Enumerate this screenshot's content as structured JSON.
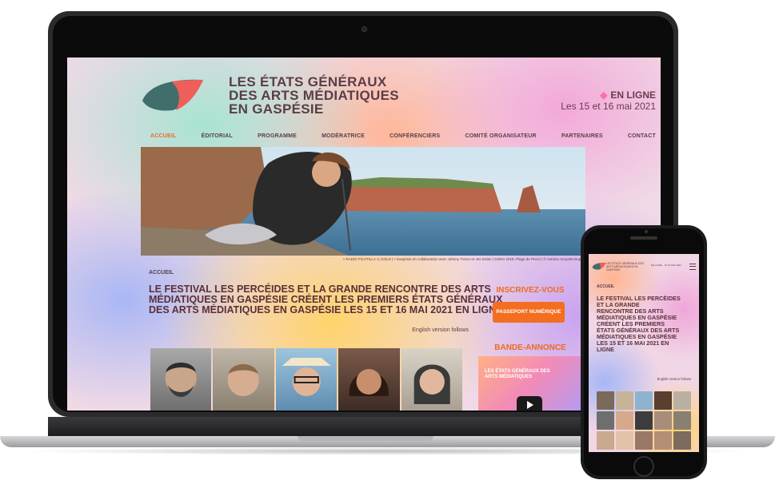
{
  "laptop_site": {
    "title_lines": [
      "LES ÉTATS GÉNÉRAUX",
      "DES ARTS MÉDIATIQUES",
      "EN GASPÉSIE"
    ],
    "online_label": "EN LIGNE",
    "dates": "Les 15 et 16 mai 2021",
    "nav": [
      "ACCUEIL",
      "ÉDITORIAL",
      "PROGRAMME",
      "MODÉRATRICE",
      "CONFÉRENCIERS",
      "COMITÉ ORGANISATEUR",
      "PARTENAIRES",
      "CONTACT"
    ],
    "nav_active": "ACCUEIL",
    "hero_credit": "« RADIO FICATILLA »( GOLD ) • Gaspésie en collaboration avec Johnny Trevor et Jes Dolan | GIWAI 2019, Plage de Percé | © Antoine Amyotte-Dupuis",
    "breadcrumb": "ACCUEIL",
    "headline_lines": [
      "LE FESTIVAL LES PERCÉIDES ET LA GRANDE RENCONTRE DES ARTS",
      "MÉDIATIQUES EN GASPÉSIE CRÉENT LES PREMIERS ÉTATS GÉNÉRAUX",
      "DES ARTS MÉDIATIQUES EN GASPÉSIE LES 15 ET 16 MAI 2021 EN LIGNE"
    ],
    "english_link": "English version follows",
    "inscrivez": "INSCRIVEZ-VOUS",
    "passport_button": "PASSEPORT NUMÉRIQUE",
    "bande_annonce": "BANDE-ANNONCE",
    "video_text": "LES ÉTATS GÉNÉRAUX DES ARTS MÉDIATIQUES"
  },
  "phone_site": {
    "mini_title": "LES ÉTATS GÉNÉRAUX DES ARTS MÉDIATIQUES EN GASPÉSIE",
    "mini_date": "EN LIGNE · 15-16 MAI 2021",
    "breadcrumb": "ACCUEIL",
    "headline_lines": [
      "LE FESTIVAL LES PERCÉIDES",
      "ET LA GRANDE",
      "RENCONTRE DES ARTS",
      "MÉDIATIQUES EN GASPÉSIE",
      "CRÉENT LES PREMIERS",
      "ÉTATS GÉNÉRAUX DES ARTS",
      "MÉDIATIQUES EN GASPÉSIE",
      "LES 15 ET 16 MAI 2021 EN",
      "LIGNE"
    ],
    "english_link": "English version follows"
  },
  "colors": {
    "accent_orange": "#f06a1e",
    "text_dark": "#5a2f3a",
    "button_orange": "#f36e1f"
  }
}
